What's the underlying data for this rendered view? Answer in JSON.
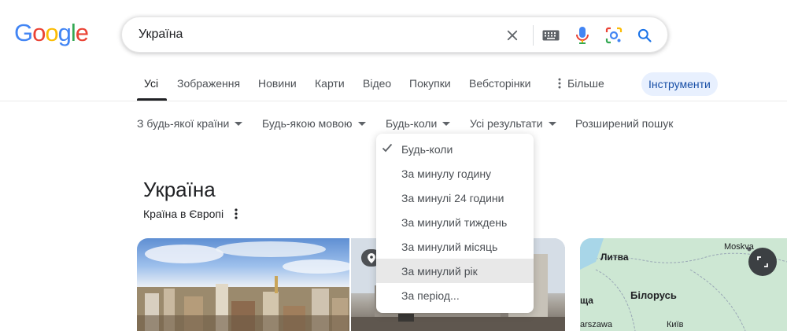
{
  "logo": {
    "letters": [
      "G",
      "o",
      "o",
      "g",
      "l",
      "e"
    ],
    "colors": [
      "#4285F4",
      "#EA4335",
      "#FBBC05",
      "#4285F4",
      "#34A853",
      "#EA4335"
    ]
  },
  "search": {
    "query": "Україна",
    "icons": [
      "close-icon",
      "keyboard-icon",
      "mic-icon",
      "lens-icon",
      "search-icon"
    ]
  },
  "tabs": {
    "items": [
      {
        "label": "Усі"
      },
      {
        "label": "Зображення"
      },
      {
        "label": "Новини"
      },
      {
        "label": "Карти"
      },
      {
        "label": "Відео"
      },
      {
        "label": "Покупки"
      },
      {
        "label": "Вебсторінки"
      },
      {
        "label": "Більше"
      }
    ],
    "tools_label": "Інструменти",
    "active": "Усі"
  },
  "filters": [
    {
      "label": "З будь-якої країни"
    },
    {
      "label": "Будь-якою мовою"
    },
    {
      "label": "Будь-коли"
    },
    {
      "label": "Усі результати"
    },
    {
      "label": "Розширений пошук"
    }
  ],
  "time_dropdown": {
    "selected": "Будь-коли",
    "highlighted": "За минулий рік",
    "items": [
      {
        "label": "Будь-коли"
      },
      {
        "label": "За минулу годину"
      },
      {
        "label": "За минулі 24 години"
      },
      {
        "label": "За минулий тиждень"
      },
      {
        "label": "За минулий місяць"
      },
      {
        "label": "За минулий рік"
      },
      {
        "label": "За період..."
      }
    ]
  },
  "knowledge_panel": {
    "title": "Україна",
    "subtitle": "Країна в Європі"
  },
  "map": {
    "labels": {
      "lithuania": "Литва",
      "moscow": "Moskva",
      "belarus": "Білорусь",
      "warsaw": "arszawa",
      "kyiv": "Київ",
      "left_partial": "ща"
    }
  },
  "colors": {
    "accent": "#1a73e8",
    "tools_bg": "#e8f0fe",
    "tools_text": "#174ea6"
  }
}
